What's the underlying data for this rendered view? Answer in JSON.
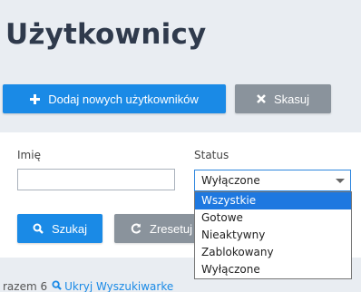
{
  "page": {
    "title": "Użytkownicy"
  },
  "toolbar": {
    "add_label": "Dodaj nowych użytkowników",
    "delete_label": "Skasuj"
  },
  "filters": {
    "name_label": "Imię",
    "name_value": "",
    "status_label": "Status",
    "status_selected": "Wyłączone",
    "status_options": [
      "Wszystkie",
      "Gotowe",
      "Nieaktywny",
      "Zablokowany",
      "Wyłączone"
    ],
    "search_label": "Szukaj",
    "reset_label": "Zresetuj"
  },
  "footer": {
    "total_text": "razem 6",
    "toggle_label": "Ukryj Wyszukiwarke"
  },
  "colors": {
    "primary": "#1a8ae6",
    "secondary": "#8a939c",
    "highlight": "#1e78e0",
    "background": "#e9edf2"
  }
}
